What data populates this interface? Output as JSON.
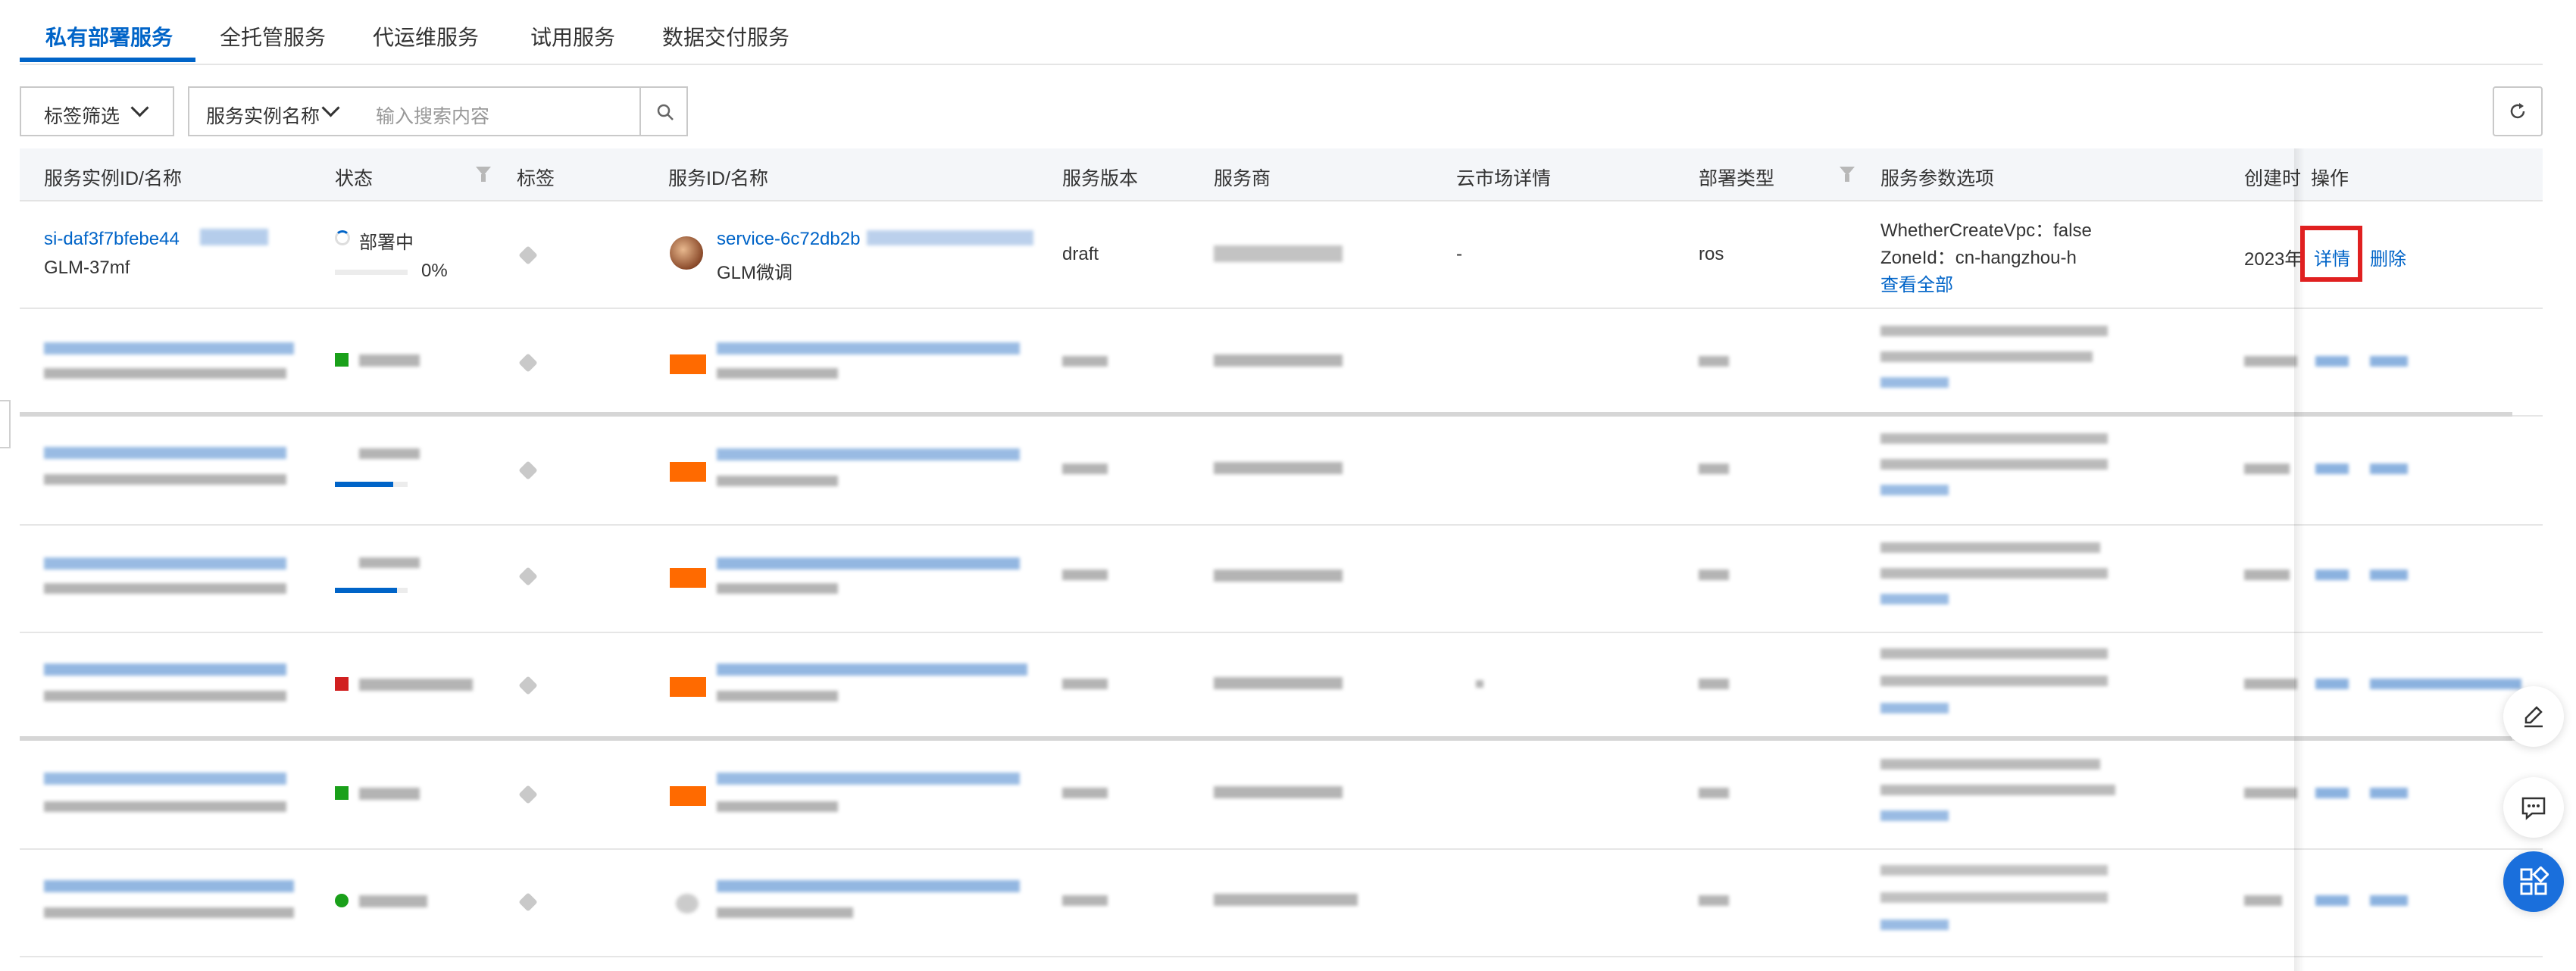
{
  "tabs": [
    {
      "label": "私有部署服务",
      "active": true
    },
    {
      "label": "全托管服务",
      "active": false
    },
    {
      "label": "代运维服务",
      "active": false
    },
    {
      "label": "试用服务",
      "active": false
    },
    {
      "label": "数据交付服务",
      "active": false
    }
  ],
  "toolbar": {
    "tag_filter_label": "标签筛选",
    "search_field_selected": "服务实例名称",
    "search_placeholder": "输入搜索内容"
  },
  "table": {
    "headers": {
      "instance": "服务实例ID/名称",
      "status": "状态",
      "tags": "标签",
      "service": "服务ID/名称",
      "version": "服务版本",
      "provider": "服务商",
      "market": "云市场详情",
      "deploy_type": "部署类型",
      "params": "服务参数选项",
      "created": "创建时",
      "actions": "操作"
    },
    "row1": {
      "instance_id": "si-daf3f7bfebe44",
      "instance_name": "GLM-37mf",
      "status": "部署中",
      "progress_text": "0%",
      "progress_value": 0,
      "service_id": "service-6c72db2b",
      "service_name": "GLM微调",
      "version": "draft",
      "market": "-",
      "deploy_type": "ros",
      "param1": "WhetherCreateVpc：false",
      "param2": "ZoneId：cn-hangzhou-h",
      "view_all": "查看全部",
      "created": "2023年",
      "detail_label": "详情",
      "delete_label": "删除"
    }
  },
  "colors": {
    "primary": "#0064c8",
    "service_orange": "#ff6a00",
    "status_green": "#1aa01a",
    "status_red": "#d12020",
    "highlight_red": "#e02020"
  }
}
